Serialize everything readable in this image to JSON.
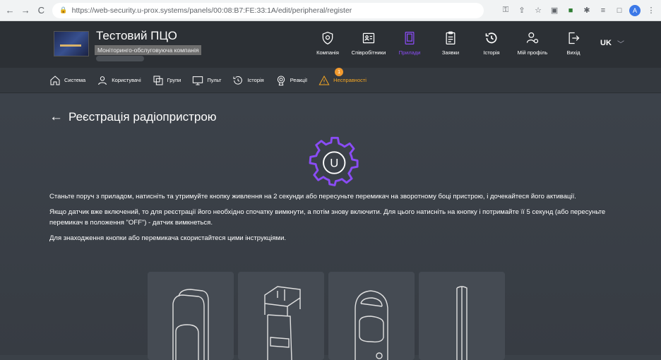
{
  "browser": {
    "url": "https://web-security.u-prox.systems/panels/00:08:B7:FE:33:1A/edit/peripheral/register",
    "profile_initial": "A"
  },
  "header": {
    "title": "Тестовий ПЦО",
    "subtitle": "Моніторинго-обслуговуюча компанія",
    "nav": [
      {
        "label": "Компанія",
        "icon": "shield-icon"
      },
      {
        "label": "Співробітники",
        "icon": "id-card-icon"
      },
      {
        "label": "Прилади",
        "icon": "device-panel-icon"
      },
      {
        "label": "Заявки",
        "icon": "clipboard-icon"
      },
      {
        "label": "Історія",
        "icon": "history-icon"
      },
      {
        "label": "Мій профіль",
        "icon": "user-gear-icon"
      },
      {
        "label": "Вихід",
        "icon": "logout-icon"
      }
    ],
    "active_nav": "Прилади",
    "language": "UK"
  },
  "subnav": {
    "items": [
      {
        "label": "Система",
        "icon": "home-icon"
      },
      {
        "label": "Користувачі",
        "icon": "user-icon"
      },
      {
        "label": "Групи",
        "icon": "groups-icon"
      },
      {
        "label": "Пульт",
        "icon": "monitor-icon"
      },
      {
        "label": "Історія",
        "icon": "history-icon"
      },
      {
        "label": "Реакції",
        "icon": "reaction-icon"
      },
      {
        "label": "Несправності",
        "icon": "warning-icon"
      }
    ],
    "alert_count": "1"
  },
  "main": {
    "title": "Реєстрація радіопристрою",
    "logo_letter": "U",
    "paragraph1": "Станьте поруч з приладом, натисніть та утримуйте кнопку живлення на 2 секунди або пересуньте перемикач на зворотному боці пристрою, і дочекайтеся його активації.",
    "paragraph2": "Якщо датчик вже включений, то для реєстрації його необхідно спочатку вимкнути, а потім знову включити. Для цього натисніть на кнопку і потримайте її 5 секунд (або пересуньте перемикач в положення \"OFF\") - датчик вимкнеться.",
    "paragraph3": "Для знаходження кнопки або перемикача скористайтеся цими інструкціями."
  },
  "colors": {
    "accent": "#8a4cf5",
    "alert": "#f5a623",
    "background": "#3b4148"
  }
}
